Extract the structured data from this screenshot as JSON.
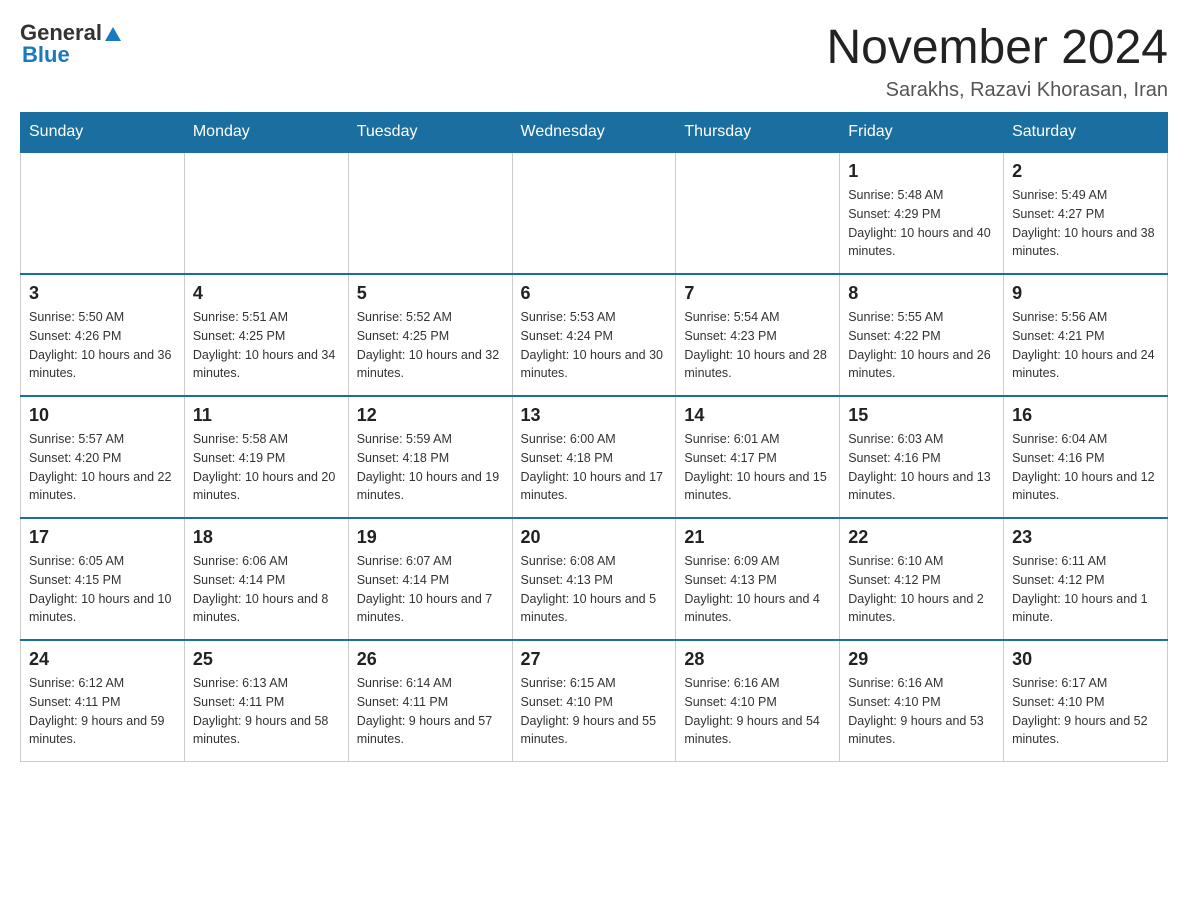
{
  "header": {
    "logo_general": "General",
    "logo_blue": "Blue",
    "title": "November 2024",
    "location": "Sarakhs, Razavi Khorasan, Iran"
  },
  "days_of_week": [
    "Sunday",
    "Monday",
    "Tuesday",
    "Wednesday",
    "Thursday",
    "Friday",
    "Saturday"
  ],
  "weeks": [
    {
      "days": [
        {
          "number": "",
          "info": ""
        },
        {
          "number": "",
          "info": ""
        },
        {
          "number": "",
          "info": ""
        },
        {
          "number": "",
          "info": ""
        },
        {
          "number": "",
          "info": ""
        },
        {
          "number": "1",
          "info": "Sunrise: 5:48 AM\nSunset: 4:29 PM\nDaylight: 10 hours and 40 minutes."
        },
        {
          "number": "2",
          "info": "Sunrise: 5:49 AM\nSunset: 4:27 PM\nDaylight: 10 hours and 38 minutes."
        }
      ]
    },
    {
      "days": [
        {
          "number": "3",
          "info": "Sunrise: 5:50 AM\nSunset: 4:26 PM\nDaylight: 10 hours and 36 minutes."
        },
        {
          "number": "4",
          "info": "Sunrise: 5:51 AM\nSunset: 4:25 PM\nDaylight: 10 hours and 34 minutes."
        },
        {
          "number": "5",
          "info": "Sunrise: 5:52 AM\nSunset: 4:25 PM\nDaylight: 10 hours and 32 minutes."
        },
        {
          "number": "6",
          "info": "Sunrise: 5:53 AM\nSunset: 4:24 PM\nDaylight: 10 hours and 30 minutes."
        },
        {
          "number": "7",
          "info": "Sunrise: 5:54 AM\nSunset: 4:23 PM\nDaylight: 10 hours and 28 minutes."
        },
        {
          "number": "8",
          "info": "Sunrise: 5:55 AM\nSunset: 4:22 PM\nDaylight: 10 hours and 26 minutes."
        },
        {
          "number": "9",
          "info": "Sunrise: 5:56 AM\nSunset: 4:21 PM\nDaylight: 10 hours and 24 minutes."
        }
      ]
    },
    {
      "days": [
        {
          "number": "10",
          "info": "Sunrise: 5:57 AM\nSunset: 4:20 PM\nDaylight: 10 hours and 22 minutes."
        },
        {
          "number": "11",
          "info": "Sunrise: 5:58 AM\nSunset: 4:19 PM\nDaylight: 10 hours and 20 minutes."
        },
        {
          "number": "12",
          "info": "Sunrise: 5:59 AM\nSunset: 4:18 PM\nDaylight: 10 hours and 19 minutes."
        },
        {
          "number": "13",
          "info": "Sunrise: 6:00 AM\nSunset: 4:18 PM\nDaylight: 10 hours and 17 minutes."
        },
        {
          "number": "14",
          "info": "Sunrise: 6:01 AM\nSunset: 4:17 PM\nDaylight: 10 hours and 15 minutes."
        },
        {
          "number": "15",
          "info": "Sunrise: 6:03 AM\nSunset: 4:16 PM\nDaylight: 10 hours and 13 minutes."
        },
        {
          "number": "16",
          "info": "Sunrise: 6:04 AM\nSunset: 4:16 PM\nDaylight: 10 hours and 12 minutes."
        }
      ]
    },
    {
      "days": [
        {
          "number": "17",
          "info": "Sunrise: 6:05 AM\nSunset: 4:15 PM\nDaylight: 10 hours and 10 minutes."
        },
        {
          "number": "18",
          "info": "Sunrise: 6:06 AM\nSunset: 4:14 PM\nDaylight: 10 hours and 8 minutes."
        },
        {
          "number": "19",
          "info": "Sunrise: 6:07 AM\nSunset: 4:14 PM\nDaylight: 10 hours and 7 minutes."
        },
        {
          "number": "20",
          "info": "Sunrise: 6:08 AM\nSunset: 4:13 PM\nDaylight: 10 hours and 5 minutes."
        },
        {
          "number": "21",
          "info": "Sunrise: 6:09 AM\nSunset: 4:13 PM\nDaylight: 10 hours and 4 minutes."
        },
        {
          "number": "22",
          "info": "Sunrise: 6:10 AM\nSunset: 4:12 PM\nDaylight: 10 hours and 2 minutes."
        },
        {
          "number": "23",
          "info": "Sunrise: 6:11 AM\nSunset: 4:12 PM\nDaylight: 10 hours and 1 minute."
        }
      ]
    },
    {
      "days": [
        {
          "number": "24",
          "info": "Sunrise: 6:12 AM\nSunset: 4:11 PM\nDaylight: 9 hours and 59 minutes."
        },
        {
          "number": "25",
          "info": "Sunrise: 6:13 AM\nSunset: 4:11 PM\nDaylight: 9 hours and 58 minutes."
        },
        {
          "number": "26",
          "info": "Sunrise: 6:14 AM\nSunset: 4:11 PM\nDaylight: 9 hours and 57 minutes."
        },
        {
          "number": "27",
          "info": "Sunrise: 6:15 AM\nSunset: 4:10 PM\nDaylight: 9 hours and 55 minutes."
        },
        {
          "number": "28",
          "info": "Sunrise: 6:16 AM\nSunset: 4:10 PM\nDaylight: 9 hours and 54 minutes."
        },
        {
          "number": "29",
          "info": "Sunrise: 6:16 AM\nSunset: 4:10 PM\nDaylight: 9 hours and 53 minutes."
        },
        {
          "number": "30",
          "info": "Sunrise: 6:17 AM\nSunset: 4:10 PM\nDaylight: 9 hours and 52 minutes."
        }
      ]
    }
  ]
}
